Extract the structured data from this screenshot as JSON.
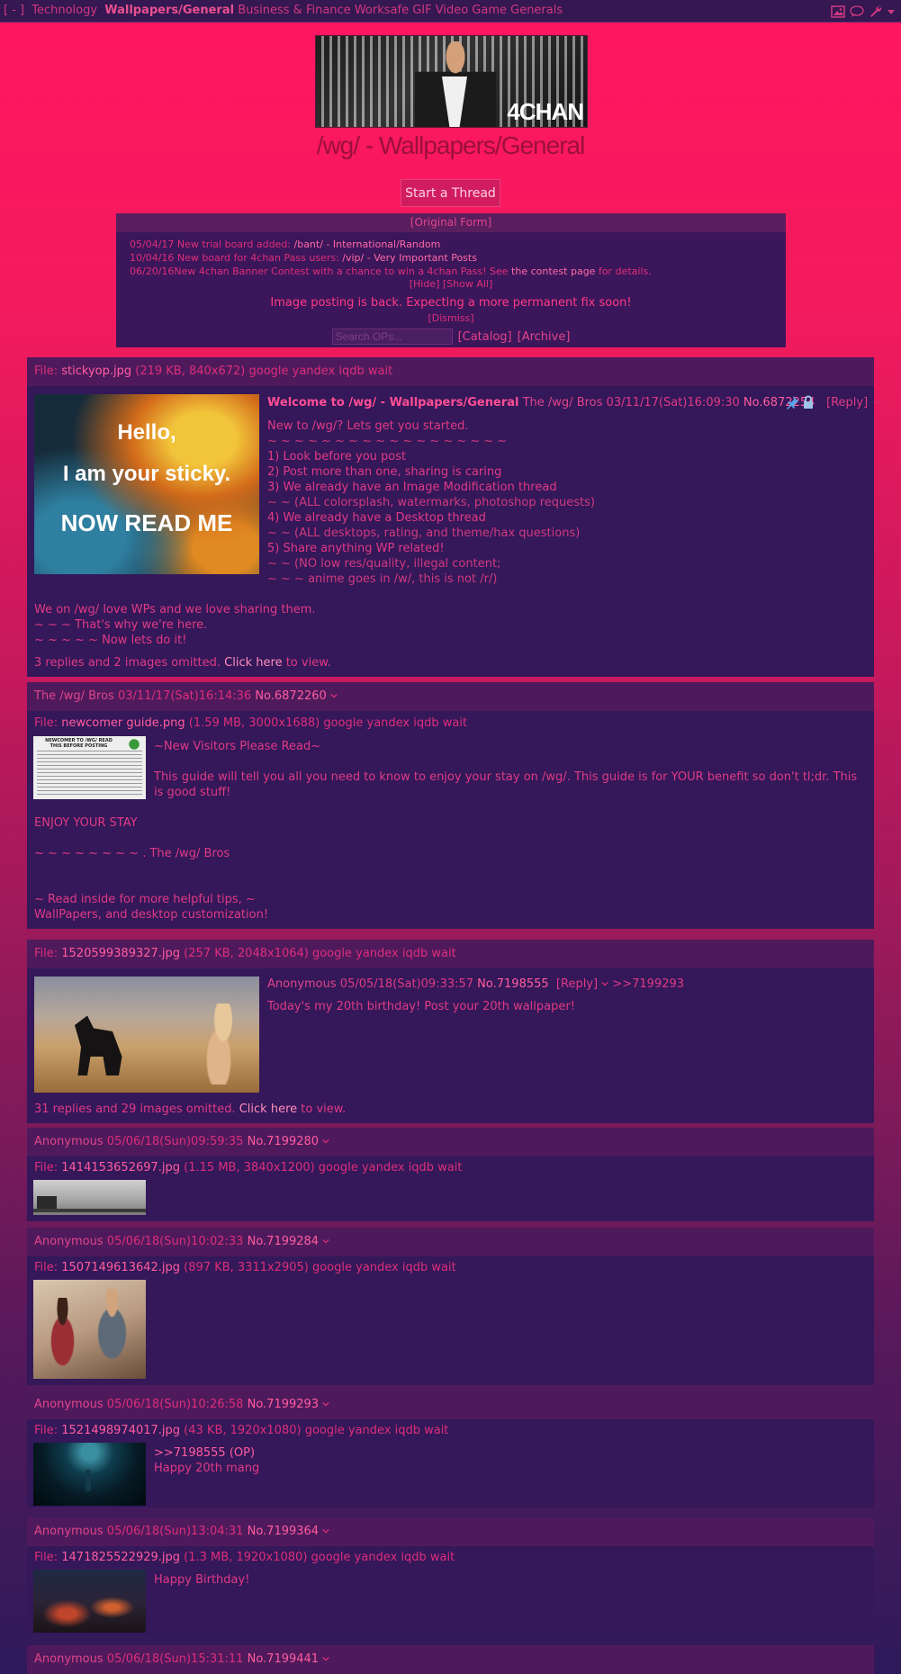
{
  "topbar": {
    "toggle": "[ - ]",
    "boards": [
      "Technology",
      "Wallpapers/General",
      "Business & Finance",
      "Worksafe GIF",
      "Video Game Generals"
    ]
  },
  "banner": {
    "logo_text": "4CHAN"
  },
  "board_title": "/wg/ - Wallpapers/General",
  "start_thread": "Start a Thread",
  "infobox": {
    "header": "[Original Form]",
    "news": [
      {
        "date": "05/04/17",
        "text": "New trial board added: ",
        "link": "/bant/ - International/Random"
      },
      {
        "date": "10/04/16",
        "text": "New board for 4chan Pass users: ",
        "link": "/vip/ - Very Important Posts"
      },
      {
        "date": "06/20/16",
        "text": "New 4chan Banner Contest with a chance to win a 4chan Pass! See ",
        "link": "the contest page",
        "tail": " for details."
      }
    ],
    "hide_show": "[Hide] [Show All]",
    "message": "Image posting is back. Expecting a more permanent fix soon!",
    "dismiss": "[Dismiss]",
    "search_placeholder": "Search OPs...",
    "catalog": "[Catalog]",
    "archive": "[Archive]"
  },
  "threads": {
    "sticky": {
      "file_label": "File: ",
      "file_name": "stickyop.jpg",
      "file_info": " (219 KB, 840x672) google yandex iqdb wait",
      "thumb_lines": [
        "Hello,",
        "I am your sticky.",
        "NOW READ ME"
      ],
      "subject": "Welcome to /wg/ - Wallpapers/General",
      "name": "The /wg/ Bros",
      "datetime": "03/11/17(Sat)16:09:30",
      "number": "No.6872254",
      "reply": "[Reply]",
      "body": [
        "New to /wg/? Lets get you started.",
        "~ ~ ~ ~ ~ ~ ~ ~ ~ ~ ~ ~ ~ ~ ~ ~ ~ ~",
        "1) Look before you post",
        "2) Post more than one, sharing is caring",
        "3) We already have an Image Modification thread",
        "~ ~ (ALL colorsplash, watermarks, photoshop requests)",
        "4) We already have a Desktop thread",
        "~ ~ (ALL desktops, rating, and theme/hax questions)",
        "5) Share anything WP related!",
        "~ ~ (NO low res/quality, illegal content;",
        "~ ~ ~ anime goes in /w/, this is not /r/)"
      ],
      "body2": [
        "We on /wg/ love WPs and we love sharing them.",
        "~ ~ ~ That's why we're here.",
        "~ ~ ~ ~ ~ Now lets do it!"
      ],
      "omitted": "3 replies and 2 images omitted. ",
      "click_here": "Click here",
      "to_view": " to view."
    },
    "sticky_reply": {
      "name": "The /wg/ Bros",
      "datetime": "03/11/17(Sat)16:14:36",
      "number": "No.6872260",
      "file_label": "File: ",
      "file_name": "newcomer guide.png",
      "file_info": " (1.59 MB, 3000x1688) google yandex iqdb wait",
      "thumb_title": "NEWCOMER TO /WG/ READ THIS BEFORE POSTING",
      "lines": [
        "~New Visitors Please Read~",
        "This guide will tell you all you need to know to enjoy your stay on /wg/. This guide is for YOUR benefit so don't tl;dr. This is good stuff!",
        "ENJOY YOUR STAY",
        "~ ~ ~ ~ ~ ~ ~ ~ . The /wg/ Bros",
        "~ Read inside for more helpful tips, ~",
        "WallPapers, and desktop customization!"
      ]
    },
    "birthday": {
      "file_label": "File: ",
      "file_name": "1520599389327.jpg",
      "file_info": " (257 KB, 2048x1064) google yandex iqdb wait",
      "name": "Anonymous",
      "datetime": "05/05/18(Sat)09:33:57",
      "number": "No.7198555",
      "reply": "[Reply]",
      "backlink": ">>7199293",
      "body": "Today's my 20th birthday! Post your 20th wallpaper!",
      "omitted": "31 replies and 29 images omitted. ",
      "click_here": "Click here",
      "to_view": " to view."
    },
    "replies": [
      {
        "name": "Anonymous",
        "datetime": "05/06/18(Sun)09:59:35",
        "number": "No.7199280",
        "file_name": "1414153652697.jpg",
        "file_info": " (1.15 MB, 3840x1200) google yandex iqdb wait",
        "lines": []
      },
      {
        "name": "Anonymous",
        "datetime": "05/06/18(Sun)10:02:33",
        "number": "No.7199284",
        "file_name": "1507149613642.jpg",
        "file_info": " (897 KB, 3311x2905) google yandex iqdb wait",
        "lines": []
      },
      {
        "name": "Anonymous",
        "datetime": "05/06/18(Sun)10:26:58",
        "number": "No.7199293",
        "file_name": "1521498974017.jpg",
        "file_info": " (43 KB, 1920x1080) google yandex iqdb wait",
        "lines": [
          ">>7198555 (OP)",
          "Happy 20th mang"
        ]
      },
      {
        "name": "Anonymous",
        "datetime": "05/06/18(Sun)13:04:31",
        "number": "No.7199364",
        "file_name": "1471825522929.jpg",
        "file_info": " (1.3 MB, 1920x1080) google yandex iqdb wait",
        "lines": [
          "Happy Birthday!"
        ]
      },
      {
        "name": "Anonymous",
        "datetime": "05/06/18(Sun)15:31:11",
        "number": "No.7199441",
        "file_name": "",
        "file_info": "",
        "lines": []
      }
    ]
  },
  "colors": {
    "accent": "#ff1660",
    "post_bg": "#341859",
    "post_header": "#4e1a5c",
    "text": "#e0448a"
  }
}
